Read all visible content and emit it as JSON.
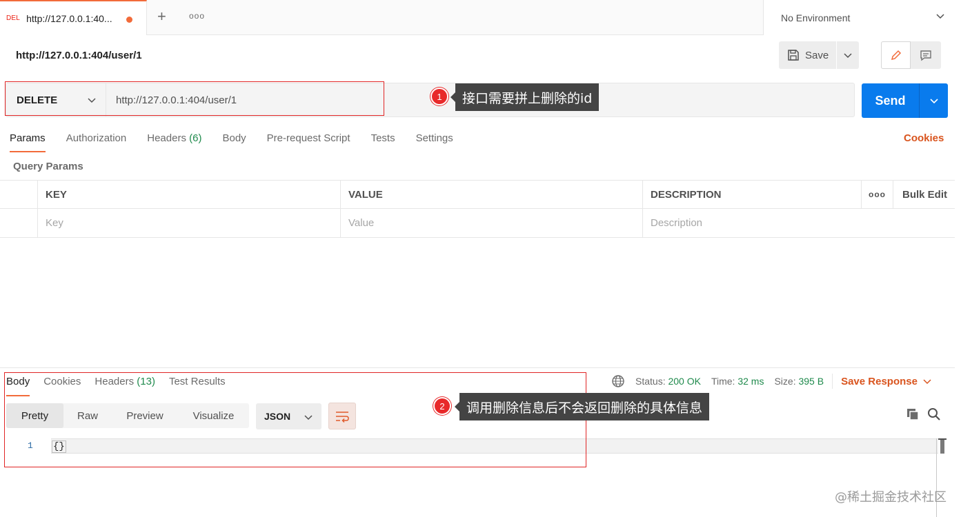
{
  "tab": {
    "method": "DEL",
    "title": "http://127.0.0.1:40...",
    "add_symbol": "+",
    "more_symbol": "ooo"
  },
  "environment": {
    "selected": "No Environment"
  },
  "request": {
    "name": "http://127.0.0.1:404/user/1",
    "save_label": "Save",
    "method": "DELETE",
    "url": "http://127.0.0.1:404/user/1",
    "send_label": "Send"
  },
  "annotations": [
    {
      "number": "1",
      "text": "接口需要拼上删除的id"
    },
    {
      "number": "2",
      "text": "调用删除信息后不会返回删除的具体信息"
    }
  ],
  "request_tabs": {
    "params": "Params",
    "authorization": "Authorization",
    "headers": "Headers",
    "headers_count": "(6)",
    "body": "Body",
    "pre_request": "Pre-request Script",
    "tests": "Tests",
    "settings": "Settings",
    "cookies": "Cookies"
  },
  "query_params": {
    "label": "Query Params",
    "headers": {
      "key": "KEY",
      "value": "VALUE",
      "description": "DESCRIPTION",
      "more": "ooo",
      "bulk_edit": "Bulk Edit"
    },
    "placeholders": {
      "key": "Key",
      "value": "Value",
      "description": "Description"
    }
  },
  "response": {
    "tabs": {
      "body": "Body",
      "cookies": "Cookies",
      "headers": "Headers",
      "headers_count": "(13)",
      "test_results": "Test Results"
    },
    "status_label": "Status:",
    "status_value": "200 OK",
    "time_label": "Time:",
    "time_value": "32 ms",
    "size_label": "Size:",
    "size_value": "395 B",
    "save_response": "Save Response",
    "views": [
      "Pretty",
      "Raw",
      "Preview",
      "Visualize"
    ],
    "format": "JSON",
    "code_line_number": "1",
    "code_text": "{}"
  },
  "watermark": "@稀土掘金技术社区",
  "colors": {
    "accent": "#f26b3a",
    "send": "#097bed",
    "method_red": "#eb2013",
    "ok_green": "#1f8a4c",
    "annotation_red": "#e8292a"
  }
}
